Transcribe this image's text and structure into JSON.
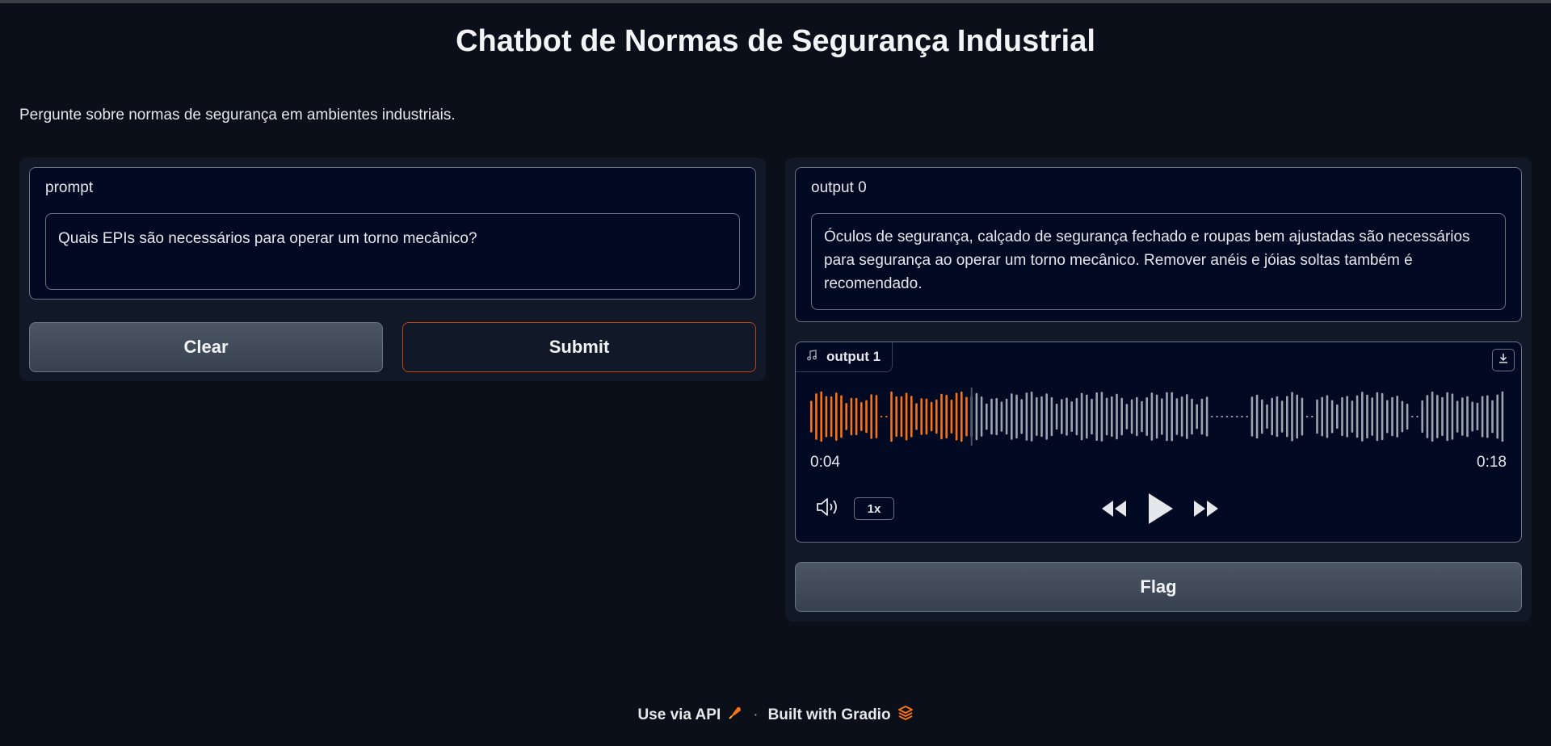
{
  "header": {
    "title": "Chatbot de Normas de Segurança Industrial",
    "description": "Pergunte sobre normas de segurança em ambientes industriais."
  },
  "input": {
    "label": "prompt",
    "value": "Quais EPIs são necessários para operar um torno mecânico?"
  },
  "buttons": {
    "clear_label": "Clear",
    "submit_label": "Submit",
    "flag_label": "Flag"
  },
  "output0": {
    "label": "output 0",
    "value": "Óculos de segurança, calçado de segurança fechado e roupas bem ajustadas são necessários para segurança ao operar um torno mecânico. Remover anéis e jóias soltas também é recomendado."
  },
  "audio": {
    "label": "output 1",
    "current_time": "0:04",
    "duration": "0:18",
    "playback_fraction": 0.23,
    "speed": "1x",
    "colors": {
      "played": "#f97316",
      "unplayed": "#9ca3af"
    }
  },
  "footer": {
    "api_label": "Use via API",
    "separator": "·",
    "built_label": "Built with Gradio"
  },
  "icons": [
    "music-note-icon",
    "download-icon",
    "volume-icon",
    "skip-backward-icon",
    "play-icon",
    "skip-forward-icon",
    "rocket-icon",
    "gradio-logo-icon"
  ]
}
